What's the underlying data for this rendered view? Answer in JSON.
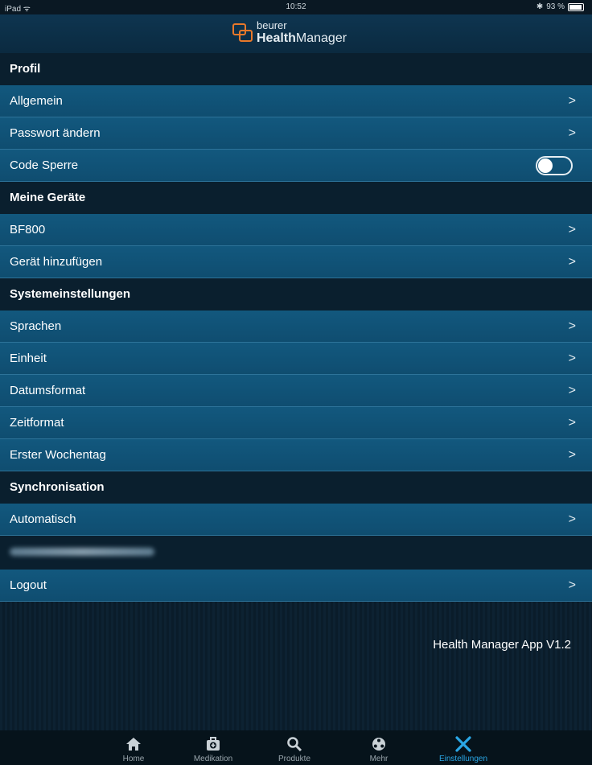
{
  "status": {
    "device": "iPad",
    "time": "10:52",
    "battery": "93 %"
  },
  "header": {
    "brand_small": "beurer",
    "brand_bold": "Health",
    "brand_rest": "Manager"
  },
  "sections": {
    "profil": "Profil",
    "geraete": "Meine Geräte",
    "system": "Systemeinstellungen",
    "sync": "Synchronisation"
  },
  "rows": {
    "allgemein": "Allgemein",
    "passwort": "Passwort ändern",
    "code": "Code Sperre",
    "bf800": "BF800",
    "geraet_add": "Gerät hinzufügen",
    "sprachen": "Sprachen",
    "einheit": "Einheit",
    "datum": "Datumsformat",
    "zeit": "Zeitformat",
    "wochentag": "Erster Wochentag",
    "automatisch": "Automatisch",
    "logout": "Logout"
  },
  "chevron": ">",
  "code_lock_enabled": false,
  "version": "Health Manager App V1.2",
  "tabs": [
    {
      "label": "Home",
      "icon": "home-icon"
    },
    {
      "label": "Medikation",
      "icon": "medkit-icon"
    },
    {
      "label": "Produkte",
      "icon": "search-icon"
    },
    {
      "label": "Mehr",
      "icon": "more-icon"
    },
    {
      "label": "Einstellungen",
      "icon": "tools-icon",
      "active": true
    }
  ],
  "colors": {
    "accent": "#2aa7e6",
    "logo": "#e8782a",
    "row": "#12587e"
  }
}
